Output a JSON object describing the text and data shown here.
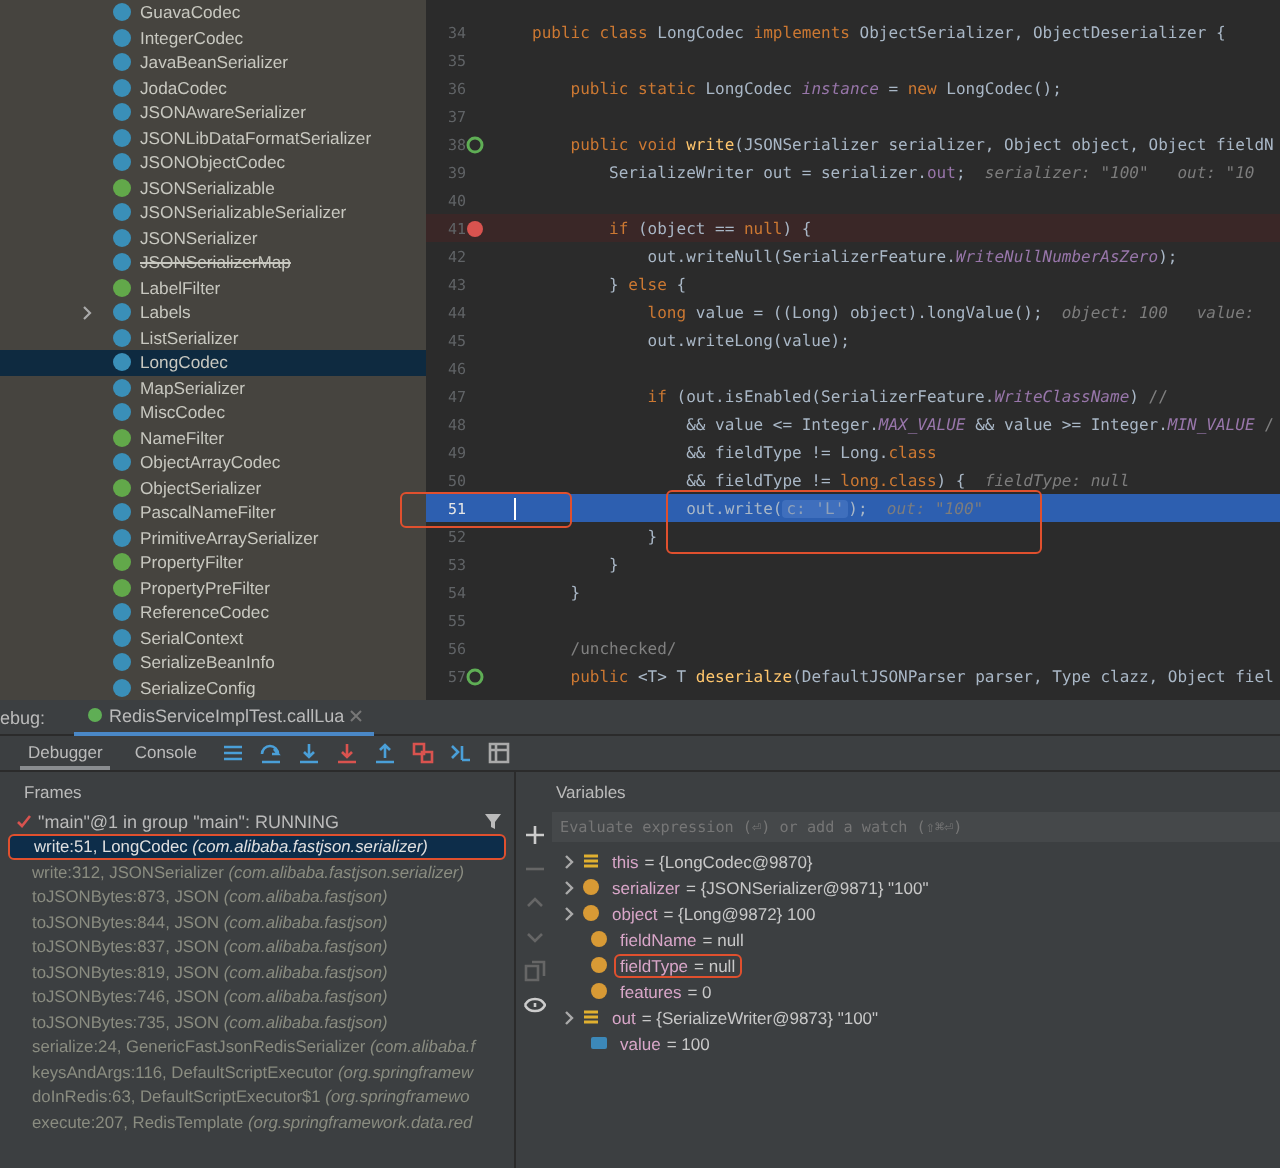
{
  "project_tree": {
    "items": [
      {
        "label": "GuavaCodec",
        "kind": "class",
        "selected": false
      },
      {
        "label": "IntegerCodec",
        "kind": "class",
        "selected": false
      },
      {
        "label": "JavaBeanSerializer",
        "kind": "class",
        "selected": false
      },
      {
        "label": "JodaCodec",
        "kind": "class",
        "selected": false
      },
      {
        "label": "JSONAwareSerializer",
        "kind": "class",
        "selected": false
      },
      {
        "label": "JSONLibDataFormatSerializer",
        "kind": "class",
        "selected": false
      },
      {
        "label": "JSONObjectCodec",
        "kind": "class",
        "selected": false
      },
      {
        "label": "JSONSerializable",
        "kind": "interface",
        "selected": false
      },
      {
        "label": "JSONSerializableSerializer",
        "kind": "class",
        "selected": false
      },
      {
        "label": "JSONSerializer",
        "kind": "class",
        "selected": false
      },
      {
        "label": "JSONSerializerMap",
        "kind": "class",
        "selected": false,
        "deprecated": true
      },
      {
        "label": "LabelFilter",
        "kind": "interface",
        "selected": false
      },
      {
        "label": "Labels",
        "kind": "class",
        "selected": false,
        "expanded": false
      },
      {
        "label": "ListSerializer",
        "kind": "class",
        "selected": false
      },
      {
        "label": "LongCodec",
        "kind": "class",
        "selected": true
      },
      {
        "label": "MapSerializer",
        "kind": "class",
        "selected": false
      },
      {
        "label": "MiscCodec",
        "kind": "class",
        "selected": false
      },
      {
        "label": "NameFilter",
        "kind": "interface",
        "selected": false
      },
      {
        "label": "ObjectArrayCodec",
        "kind": "class",
        "selected": false
      },
      {
        "label": "ObjectSerializer",
        "kind": "interface",
        "selected": false
      },
      {
        "label": "PascalNameFilter",
        "kind": "class",
        "selected": false
      },
      {
        "label": "PrimitiveArraySerializer",
        "kind": "class",
        "selected": false
      },
      {
        "label": "PropertyFilter",
        "kind": "interface",
        "selected": false
      },
      {
        "label": "PropertyPreFilter",
        "kind": "interface",
        "selected": false
      },
      {
        "label": "ReferenceCodec",
        "kind": "class",
        "selected": false
      },
      {
        "label": "SerialContext",
        "kind": "class",
        "selected": false
      },
      {
        "label": "SerializeBeanInfo",
        "kind": "class",
        "selected": false
      },
      {
        "label": "SerializeConfig",
        "kind": "class",
        "selected": false
      }
    ]
  },
  "editor": {
    "lines": [
      {
        "number": "34",
        "segments": [
          {
            "kind": "kw",
            "s": "public class "
          },
          {
            "kind": "plain",
            "s": "LongCodec "
          },
          {
            "kind": "kw",
            "s": "implements "
          },
          {
            "kind": "plain",
            "s": "ObjectSerializer, ObjectDeserializer {"
          }
        ]
      },
      {
        "number": "35"
      },
      {
        "number": "36",
        "segments": [
          {
            "kind": "kw",
            "s": "    public static "
          },
          {
            "kind": "plain",
            "s": "LongCodec "
          },
          {
            "kind": "static",
            "s": "instance"
          },
          {
            "kind": "plain",
            "s": " = "
          },
          {
            "kind": "kw",
            "s": "new "
          },
          {
            "kind": "plain",
            "s": "LongCodec();"
          }
        ]
      },
      {
        "number": "37"
      },
      {
        "number": "38",
        "kind": "override",
        "segments": [
          {
            "kind": "kw",
            "s": "    public void "
          },
          {
            "kind": "fn",
            "s": "write"
          },
          {
            "kind": "plain",
            "s": "(JSONSerializer serializer, Object object, Object fieldN"
          }
        ]
      },
      {
        "number": "39",
        "segments": [
          {
            "kind": "plain",
            "s": "        SerializeWriter out = serializer."
          },
          {
            "kind": "field",
            "s": "out"
          },
          {
            "kind": "plain",
            "s": ";  "
          },
          {
            "kind": "hint",
            "s": "serializer: \"100\"   out: \"10"
          }
        ]
      },
      {
        "number": "40"
      },
      {
        "number": "41",
        "kind": "breakpoint",
        "segments": [
          {
            "kind": "kw",
            "s": "        if "
          },
          {
            "kind": "plain",
            "s": "(object == "
          },
          {
            "kind": "kw",
            "s": "null"
          },
          {
            "kind": "plain",
            "s": ") {"
          }
        ]
      },
      {
        "number": "42",
        "segments": [
          {
            "kind": "plain",
            "s": "            out.writeNull(SerializerFeature."
          },
          {
            "kind": "static",
            "s": "WriteNullNumberAsZero"
          },
          {
            "kind": "plain",
            "s": ");"
          }
        ]
      },
      {
        "number": "43",
        "segments": [
          {
            "kind": "plain",
            "s": "        } "
          },
          {
            "kind": "kw",
            "s": "else "
          },
          {
            "kind": "plain",
            "s": "{"
          }
        ]
      },
      {
        "number": "44",
        "segments": [
          {
            "kind": "kw",
            "s": "            long "
          },
          {
            "kind": "plain",
            "s": "value = ((Long) object).longValue();  "
          },
          {
            "kind": "hint",
            "s": "object: 100   value:"
          }
        ]
      },
      {
        "number": "45",
        "segments": [
          {
            "kind": "plain",
            "s": "            out.writeLong(value);"
          }
        ]
      },
      {
        "number": "46"
      },
      {
        "number": "47",
        "segments": [
          {
            "kind": "kw",
            "s": "            if "
          },
          {
            "kind": "plain",
            "s": "(out.isEnabled(SerializerFeature."
          },
          {
            "kind": "static",
            "s": "WriteClassName"
          },
          {
            "kind": "plain",
            "s": ") "
          },
          {
            "kind": "comment",
            "s": "//"
          }
        ]
      },
      {
        "number": "48",
        "segments": [
          {
            "kind": "plain",
            "s": "                && value <= Integer."
          },
          {
            "kind": "static",
            "s": "MAX_VALUE"
          },
          {
            "kind": "plain",
            "s": " && value >= Integer."
          },
          {
            "kind": "static",
            "s": "MIN_VALUE"
          },
          {
            "kind": "comment",
            "s": " /"
          }
        ]
      },
      {
        "number": "49",
        "segments": [
          {
            "kind": "plain",
            "s": "                && fieldType != Long."
          },
          {
            "kind": "kw",
            "s": "class"
          }
        ]
      },
      {
        "number": "50",
        "segments": [
          {
            "kind": "plain",
            "s": "                && fieldType != "
          },
          {
            "kind": "kw",
            "s": "long.class"
          },
          {
            "kind": "plain",
            "s": ") {  "
          },
          {
            "kind": "hint",
            "s": "fieldType: null"
          }
        ]
      },
      {
        "number": "51",
        "current": true,
        "annotated": true,
        "segments": [
          {
            "kind": "plain",
            "s": "                out.write("
          },
          {
            "kind": "param",
            "s": "c: 'L'"
          },
          {
            "kind": "plain",
            "s": ");  "
          },
          {
            "kind": "hint",
            "s": "out: \"100\""
          }
        ]
      },
      {
        "number": "52",
        "segments": [
          {
            "kind": "plain",
            "s": "            }"
          }
        ]
      },
      {
        "number": "53",
        "segments": [
          {
            "kind": "plain",
            "s": "        }"
          }
        ]
      },
      {
        "number": "54",
        "segments": [
          {
            "kind": "plain",
            "s": "    }"
          }
        ]
      },
      {
        "number": "55"
      },
      {
        "number": "56",
        "segments": [
          {
            "kind": "comment",
            "s": "    /unchecked/"
          }
        ]
      },
      {
        "number": "57",
        "kind": "override",
        "segments": [
          {
            "kind": "kw",
            "s": "    public "
          },
          {
            "kind": "plain",
            "s": "<T> T "
          },
          {
            "kind": "fn",
            "s": "deserialze"
          },
          {
            "kind": "plain",
            "s": "(DefaultJSONParser parser, Type clazz, Object fiel"
          }
        ]
      }
    ]
  },
  "debug": {
    "label": "ebug:",
    "session_tab": "RedisServiceImplTest.callLua",
    "tabs": [
      {
        "label": "Debugger",
        "selected": true
      },
      {
        "label": "Console",
        "selected": false
      }
    ],
    "frames": {
      "title": "Frames",
      "thread": "\"main\"@1 in group \"main\": RUNNING",
      "items": [
        {
          "text": "write:51, LongCodec *(com.alibaba.fastjson.serializer)*",
          "selected": true,
          "annotated": true
        },
        {
          "text": "write:312, JSONSerializer *(com.alibaba.fastjson.serializer)*",
          "selected": false,
          "annotated": false
        },
        {
          "text": "toJSONBytes:873, JSON *(com.alibaba.fastjson)*",
          "selected": false,
          "annotated": false
        },
        {
          "text": "toJSONBytes:844, JSON *(com.alibaba.fastjson)*",
          "selected": false,
          "annotated": false
        },
        {
          "text": "toJSONBytes:837, JSON *(com.alibaba.fastjson)*",
          "selected": false,
          "annotated": false
        },
        {
          "text": "toJSONBytes:819, JSON *(com.alibaba.fastjson)*",
          "selected": false,
          "annotated": false
        },
        {
          "text": "toJSONBytes:746, JSON *(com.alibaba.fastjson)*",
          "selected": false,
          "annotated": false
        },
        {
          "text": "toJSONBytes:735, JSON *(com.alibaba.fastjson)*",
          "selected": false,
          "annotated": false
        },
        {
          "text": "serialize:24, GenericFastJsonRedisSerializer *(com.alibaba.f*",
          "selected": false,
          "annotated": false
        },
        {
          "text": "keysAndArgs:116, DefaultScriptExecutor *(org.springframew*",
          "selected": false,
          "annotated": false
        },
        {
          "text": "doInRedis:63, DefaultScriptExecutor$1 *(org.springframewo*",
          "selected": false,
          "annotated": false
        },
        {
          "text": "execute:207, RedisTemplate *(org.springframework.data.red*",
          "selected": false,
          "annotated": false
        }
      ]
    },
    "variables": {
      "title": "Variables",
      "placeholder": "Evaluate expression (⏎) or add a watch (⇧⌘⏎)",
      "items": [
        {
          "name": "this",
          "value": "= {LongCodec@9870}",
          "kind": "object",
          "expandable": true,
          "annotated": false
        },
        {
          "name": "serializer",
          "value": "= {JSONSerializer@9871} \"100\"",
          "kind": "param",
          "expandable": true,
          "annotated": false
        },
        {
          "name": "object",
          "value": "= {Long@9872} 100",
          "kind": "param",
          "expandable": true,
          "annotated": false
        },
        {
          "name": "fieldName",
          "value": "= null",
          "kind": "param",
          "expandable": false,
          "annotated": false
        },
        {
          "name": "fieldType",
          "value": "= null",
          "kind": "param",
          "expandable": false,
          "annotated": true
        },
        {
          "name": "features",
          "value": "= 0",
          "kind": "param",
          "expandable": false,
          "annotated": false
        },
        {
          "name": "out",
          "value": "= {SerializeWriter@9873} \"100\"",
          "kind": "object",
          "expandable": true,
          "annotated": false
        },
        {
          "name": "value",
          "value": "= 100",
          "kind": "local",
          "expandable": false,
          "annotated": false
        }
      ]
    }
  }
}
